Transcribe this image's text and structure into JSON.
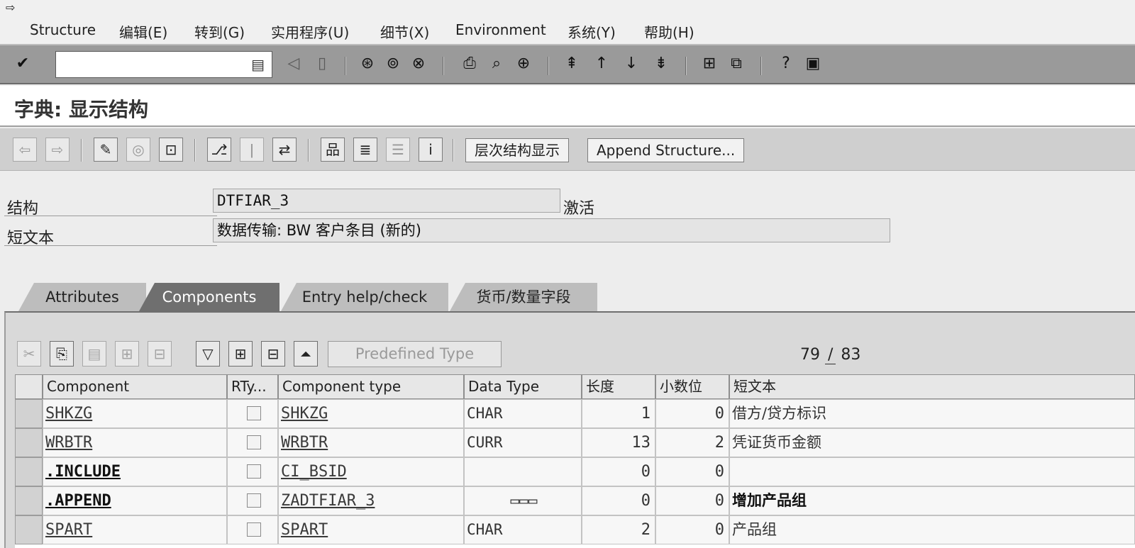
{
  "menu": {
    "system_icon": "exit-icon",
    "items": [
      "Structure",
      "编辑(E)",
      "转到(G)",
      "实用程序(U)",
      "细节(X)",
      "Environment",
      "系统(Y)",
      "帮助(H)"
    ]
  },
  "std_toolbar": {
    "command_value": "",
    "icons": [
      "enter-check-icon",
      "command-dropdown-icon",
      "back-arrow-icon",
      "save-icon",
      "back-icon",
      "exit-icon",
      "cancel-icon",
      "print-icon",
      "find-icon",
      "find-next-icon",
      "first-page-icon",
      "previous-page-icon",
      "next-page-icon",
      "last-page-icon",
      "create-session-icon",
      "shortcut-icon",
      "help-icon",
      "layout-icon"
    ]
  },
  "title": "字典: 显示结构",
  "app_toolbar": {
    "hierarchy_button": "层次结构显示",
    "append_button": "Append Structure...",
    "icons": [
      "back-arrow-icon",
      "forward-arrow-icon",
      "display-change-icon",
      "other-object-icon",
      "activate-icon",
      "where-used-icon",
      "info-icon",
      "navigate-icon",
      "hierarchy-icon",
      "collapse-icon",
      "object-list-icon",
      "info-system-icon"
    ]
  },
  "header": {
    "structure_label": "结构",
    "structure_value": "DTFIAR_3",
    "status": "激活",
    "short_text_label": "短文本",
    "short_text_value": "数据传输: BW 客户条目 (新的)"
  },
  "tabs": [
    {
      "label": "Attributes",
      "active": false
    },
    {
      "label": "Components",
      "active": true
    },
    {
      "label": "Entry help/check",
      "active": false
    },
    {
      "label": "货币/数量字段",
      "active": false
    }
  ],
  "table_toolbar": {
    "predefined_type_button": "Predefined Type",
    "current_row": "79",
    "separator": "/",
    "total_rows": "83",
    "icons": [
      "cut-icon",
      "copy-icon",
      "paste-icon",
      "insert-row-icon",
      "delete-row-icon",
      "filter-icon",
      "expand-icon",
      "collapse-icon",
      "sort-icon"
    ]
  },
  "table": {
    "columns": [
      "Component",
      "RTy...",
      "Component type",
      "Data Type",
      "长度",
      "小数位",
      "短文本"
    ],
    "rows": [
      {
        "component": "SHKZG",
        "rtype": false,
        "component_type": "SHKZG",
        "data_type": "CHAR",
        "length": "1",
        "decimals": "0",
        "short_text": "借方/贷方标识",
        "bold": false
      },
      {
        "component": "WRBTR",
        "rtype": false,
        "component_type": "WRBTR",
        "data_type": "CURR",
        "length": "13",
        "decimals": "2",
        "short_text": "凭证货币金额",
        "bold": false
      },
      {
        "component": ".INCLUDE",
        "rtype": false,
        "component_type": "CI_BSID",
        "data_type": "",
        "length": "0",
        "decimals": "0",
        "short_text": "",
        "bold": true
      },
      {
        "component": ".APPEND",
        "rtype": false,
        "component_type": "ZADTFIAR_3",
        "data_type": "▭▭▭",
        "length": "0",
        "decimals": "0",
        "short_text": "增加产品组",
        "bold": true
      },
      {
        "component": "SPART",
        "rtype": false,
        "component_type": "SPART",
        "data_type": "CHAR",
        "length": "2",
        "decimals": "0",
        "short_text": "产品组",
        "bold": false
      }
    ]
  }
}
